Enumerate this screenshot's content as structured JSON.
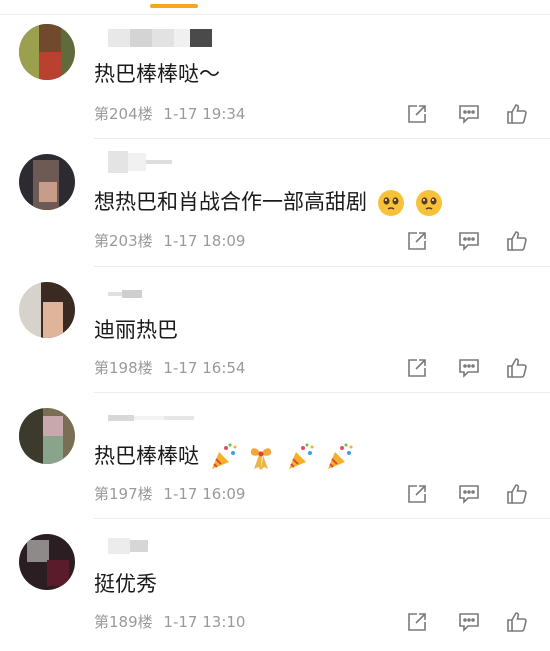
{
  "comments": [
    {
      "username": "",
      "text": "热巴棒棒哒～",
      "floor": "第204楼",
      "time": "1-17 19:34",
      "emoji": []
    },
    {
      "username": "",
      "text": "想热巴和肖战合作一部高甜剧",
      "floor": "第203楼",
      "time": "1-17 18:09",
      "emoji": [
        "pleading-face-icon",
        "pleading-face-icon"
      ]
    },
    {
      "username": "",
      "text": "迪丽热巴",
      "floor": "第198楼",
      "time": "1-17 16:54",
      "emoji": []
    },
    {
      "username": "",
      "text": "热巴棒棒哒",
      "floor": "第197楼",
      "time": "1-17 16:09",
      "emoji": [
        "party-popper-icon",
        "ribbon-gift-icon",
        "party-popper-icon",
        "party-popper-icon"
      ]
    },
    {
      "username": "",
      "text": "挺优秀",
      "floor": "第189楼",
      "time": "1-17 13:10",
      "emoji": []
    }
  ],
  "colors": {
    "accent": "#f6a623",
    "meta": "#9a9a9a",
    "icon": "#7a7a7a"
  },
  "icons": {
    "share": "share-icon",
    "reply": "comment-icon",
    "like": "thumbs-up-icon"
  }
}
